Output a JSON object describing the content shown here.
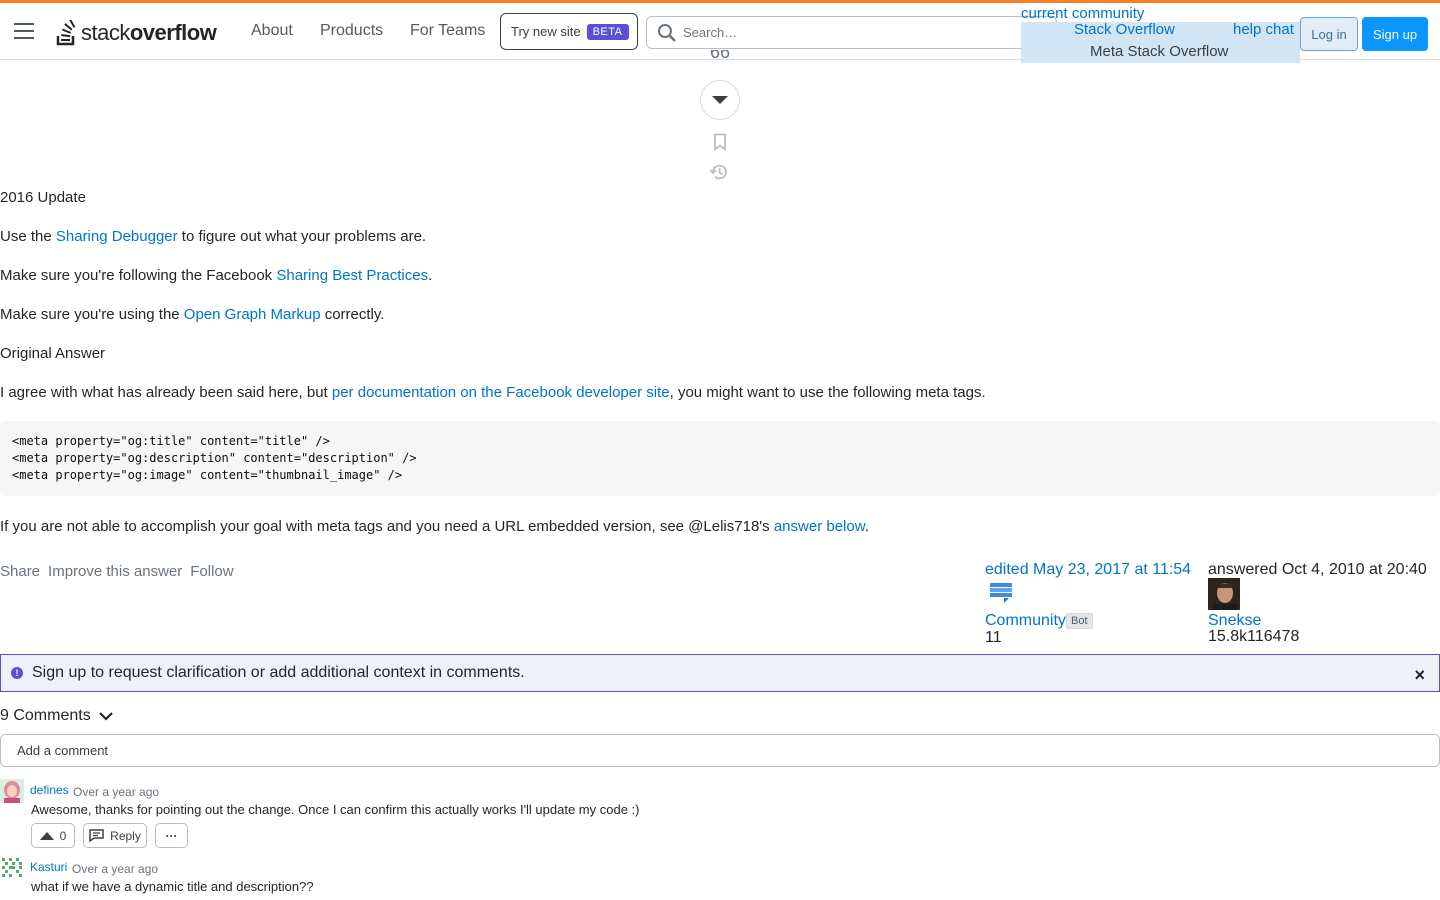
{
  "header": {
    "logo": {
      "prefix": "stack",
      "suffix": "overflow"
    },
    "nav": [
      "About",
      "Products",
      "For Teams"
    ],
    "try_new_site": "Try new site",
    "beta": "BETA",
    "search_placeholder": "Search…",
    "current_community": "current community",
    "community_so": "Stack Overflow",
    "community_meta": "Meta Stack Overflow",
    "help_chat": "help chat",
    "login": "Log in",
    "signup": "Sign up",
    "accent_color": "#f48225"
  },
  "post": {
    "vote_count": "66",
    "update_heading": "2016 Update",
    "p1": {
      "before": "Use the ",
      "link": "Sharing Debugger",
      "after": " to figure out what your problems are."
    },
    "p2": {
      "before": "Make sure you're following the Facebook ",
      "link": "Sharing Best Practices",
      "after": "."
    },
    "p3": {
      "before": "Make sure you're using the ",
      "link": "Open Graph Markup",
      "after": " correctly."
    },
    "original_heading": "Original Answer",
    "p4": {
      "before": "I agree with what has already been said here, but ",
      "link": "per documentation on the Facebook developer site",
      "after": ", you might want to use the following meta tags."
    },
    "code_lines": [
      "<meta property=\"og:title\" content=\"title\" />",
      "<meta property=\"og:description\" content=\"description\" />",
      "<meta property=\"og:image\" content=\"thumbnail_image\" />"
    ],
    "p5": {
      "before": "If you are not able to accomplish your goal with meta tags and you need a URL embedded version, see @Lelis718's ",
      "link": "answer below",
      "after": "."
    },
    "actions": [
      "Share",
      "Improve this answer",
      "Follow"
    ],
    "edited": {
      "time": "edited May 23, 2017 at 11:54",
      "user": "Community",
      "badge": "Bot",
      "rep": "11"
    },
    "answered": {
      "time": "answered Oct 4, 2010 at 20:40",
      "user": "Snekse",
      "rep": "15.8k116478"
    }
  },
  "notice": {
    "text": "Sign up to request clarification or add additional context in comments.",
    "close": "×"
  },
  "comments": {
    "count_label": "9 Comments",
    "add_placeholder": "Add a comment",
    "items": [
      {
        "user": "defines",
        "time": "Over a year ago",
        "text": "Awesome, thanks for pointing out the change. Once I can confirm this actually works I'll update my code :)",
        "votes": "0",
        "reply": "Reply",
        "more": "···"
      },
      {
        "user": "Kasturi",
        "time": "Over a year ago",
        "text": "what if we have a dynamic title and description??"
      }
    ]
  }
}
